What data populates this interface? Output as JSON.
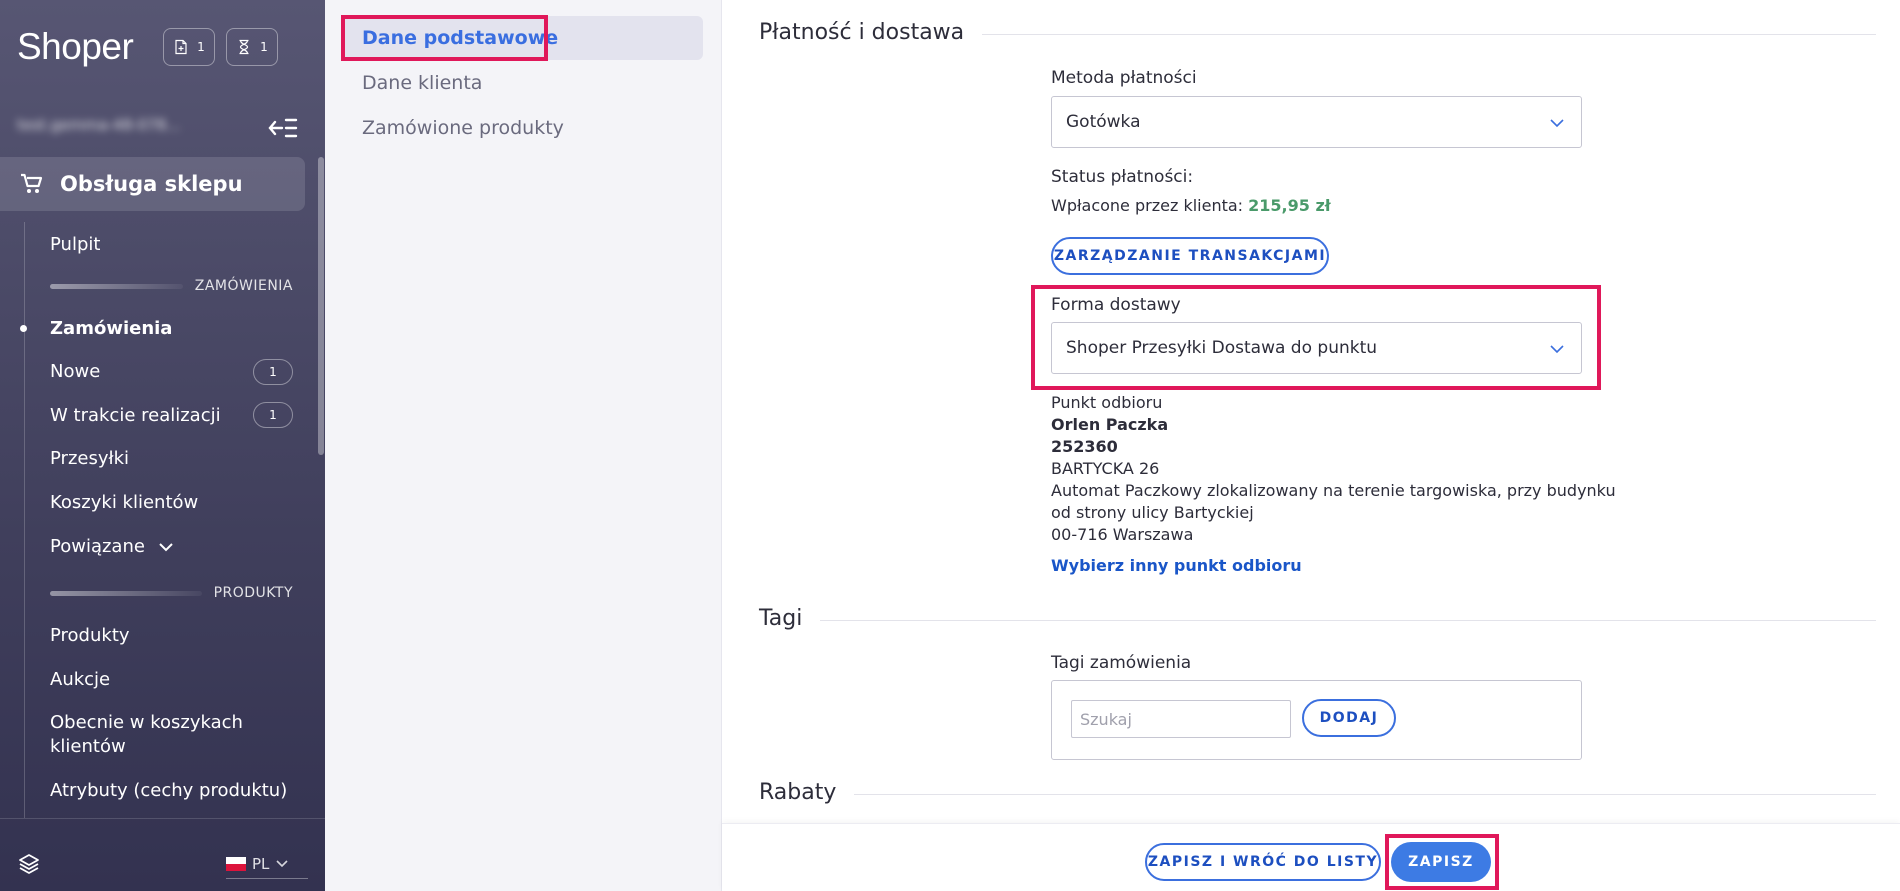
{
  "sidebar": {
    "logo": "Shoper",
    "badges": [
      {
        "icon": "document-icon",
        "count": "1"
      },
      {
        "icon": "hourglass-icon",
        "count": "1"
      }
    ],
    "store_name": "test.gemma-48-078...",
    "section": {
      "icon": "cart-icon",
      "label": "Obsługa sklepu"
    },
    "items": {
      "pulpit": "Pulpit",
      "group_orders": "ZAMÓWIENIA",
      "zamowienia": "Zamówienia",
      "nowe": "Nowe",
      "nowe_count": "1",
      "w_trakcie": "W trakcie realizacji",
      "w_trakcie_count": "1",
      "przesylki": "Przesyłki",
      "koszyki": "Koszyki klientów",
      "powiazane": "Powiązane",
      "group_products": "PRODUKTY",
      "produkty": "Produkty",
      "aukcje": "Aukcje",
      "obecnie_line1": "Obecnie w koszykach",
      "obecnie_line2": "klientów",
      "atrybuty": "Atrybuty (cechy produktu)"
    },
    "language": "PL"
  },
  "tabs": [
    {
      "label": "Dane podstawowe",
      "active": true
    },
    {
      "label": "Dane klienta",
      "active": false
    },
    {
      "label": "Zamówione produkty",
      "active": false
    }
  ],
  "payment": {
    "section_title": "Płatność i dostawa",
    "method_label": "Metoda płatności",
    "method_value": "Gotówka",
    "status_label": "Status płatności:",
    "paid_prefix": "Wpłacone przez klienta:",
    "paid_amount": "215,95 zł",
    "transactions_button": "ZARZĄDZANIE TRANSAKCJAMI",
    "delivery_label": "Forma dostawy",
    "delivery_value": "Shoper Przesyłki Dostawa do punktu"
  },
  "pickup": {
    "title": "Punkt odbioru",
    "name": "Orlen Paczka",
    "code": "252360",
    "street": "BARTYCKA 26",
    "desc_line1": "Automat Paczkowy zlokalizowany na terenie targowiska, przy budynku",
    "desc_line2": "od strony ulicy Bartyckiej",
    "city": "00-716 Warszawa",
    "change_link": "Wybierz inny punkt odbioru"
  },
  "tags": {
    "section_title": "Tagi",
    "label": "Tagi zamówienia",
    "placeholder": "Szukaj",
    "add_button": "DODAJ"
  },
  "discounts": {
    "section_title": "Rabaty"
  },
  "footer": {
    "save_back": "ZAPISZ I WRÓĆ DO LISTY",
    "save": "ZAPISZ"
  }
}
